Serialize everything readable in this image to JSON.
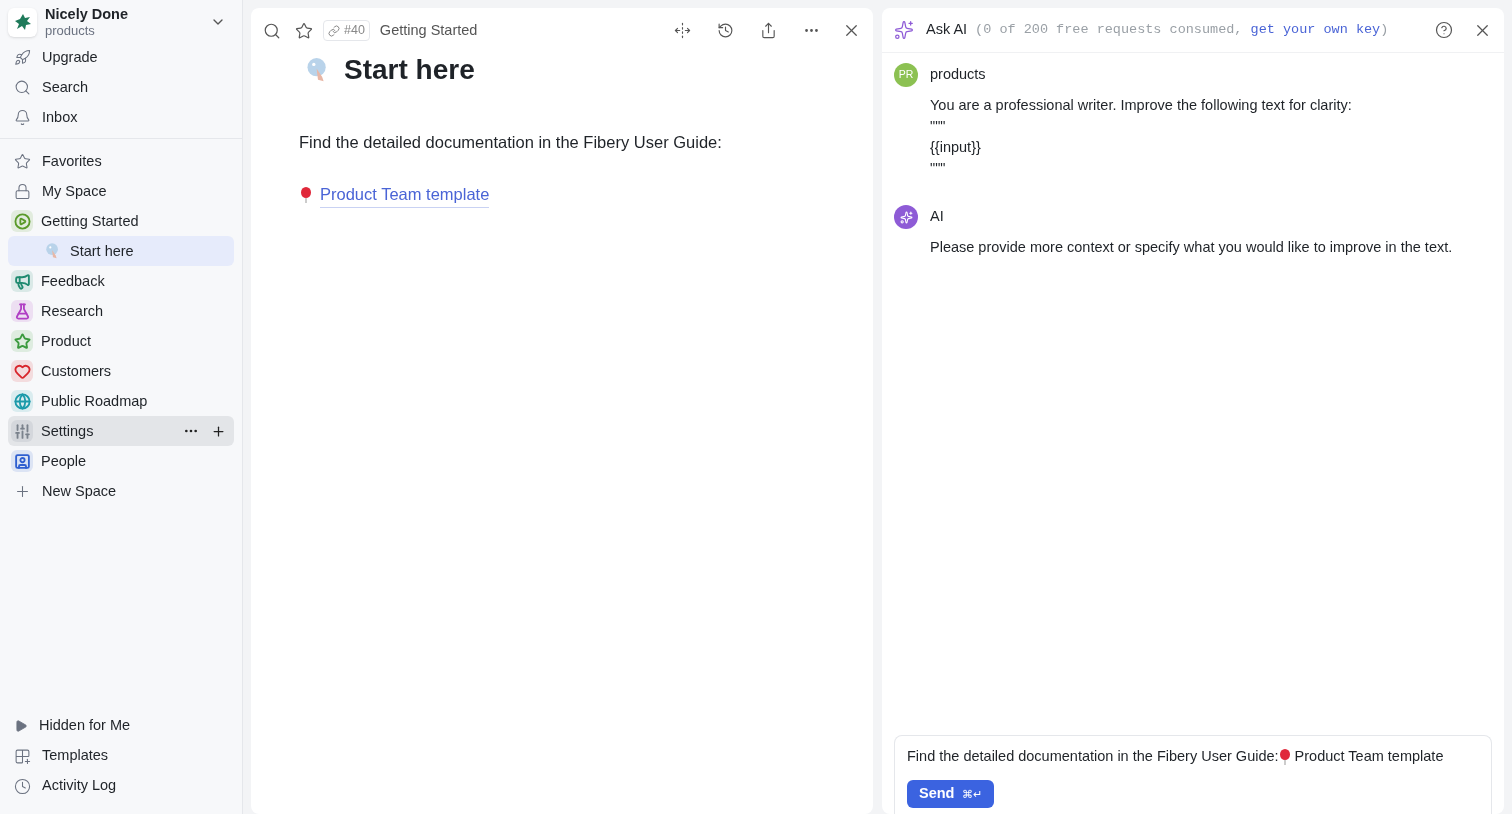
{
  "sidebar": {
    "workspace": {
      "name": "Nicely Done",
      "subtitle": "products"
    },
    "nav": [
      {
        "kind": "upgrade",
        "label": "Upgrade"
      },
      {
        "kind": "search",
        "label": "Search"
      },
      {
        "kind": "inbox",
        "label": "Inbox"
      }
    ],
    "spaces": [
      {
        "kind": "favorites",
        "label": "Favorites",
        "selected": false,
        "hovered": false
      },
      {
        "kind": "lock",
        "label": "My Space",
        "selected": false,
        "hovered": false
      },
      {
        "kind": "play",
        "label": "Getting Started",
        "color": "#5a9a2a",
        "selected": false,
        "hovered": false,
        "children": [
          {
            "kind": "sphere",
            "label": "Start here",
            "selected": true,
            "hovered": false
          }
        ]
      },
      {
        "kind": "megaphone",
        "label": "Feedback",
        "color": "#1f8a70",
        "selected": false,
        "hovered": false
      },
      {
        "kind": "flask",
        "label": "Research",
        "color": "#b03fc4",
        "selected": false,
        "hovered": false
      },
      {
        "kind": "star",
        "label": "Product",
        "color": "#3a9a3e",
        "selected": false,
        "hovered": false
      },
      {
        "kind": "heart",
        "label": "Customers",
        "color": "#d8262c",
        "selected": false,
        "hovered": false
      },
      {
        "kind": "globe",
        "label": "Public Roadmap",
        "color": "#1b9aaa",
        "selected": false,
        "hovered": false
      },
      {
        "kind": "sliders",
        "label": "Settings",
        "color": "#7a828c",
        "selected": false,
        "hovered": true
      },
      {
        "kind": "person",
        "label": "People",
        "color": "#2f5fd0",
        "selected": false,
        "hovered": false
      },
      {
        "kind": "plus",
        "label": "New Space",
        "selected": false,
        "hovered": false
      }
    ],
    "footer": [
      {
        "kind": "caret",
        "label": "Hidden for Me"
      },
      {
        "kind": "templates",
        "label": "Templates"
      },
      {
        "kind": "clock",
        "label": "Activity Log"
      }
    ]
  },
  "document": {
    "id": "#40",
    "breadcrumb": "Getting Started",
    "title": "Start here",
    "paragraph": "Find the detailed documentation in the Fibery User Guide:",
    "link": "Product Team template"
  },
  "ai_panel": {
    "title": "Ask AI",
    "usage_prefix": "(0 of 200 free requests consumed, ",
    "usage_link": "get your own key",
    "usage_suffix": ")",
    "messages": [
      {
        "kind": "user",
        "author": "products",
        "initials": "PR",
        "lines": [
          "You are a professional writer. Improve the following text for clarity:",
          "\"\"\"",
          "{{input}}",
          "\"\"\""
        ]
      },
      {
        "kind": "ai",
        "author": "AI",
        "lines": [
          "Please provide more context or specify what you would like to improve in the text."
        ]
      }
    ],
    "input": {
      "value_before": "Find the detailed documentation in the Fibery User Guide:",
      "value_after": " Product Team template"
    },
    "send": {
      "label": "Send",
      "shortcut": "⌘↵"
    }
  }
}
